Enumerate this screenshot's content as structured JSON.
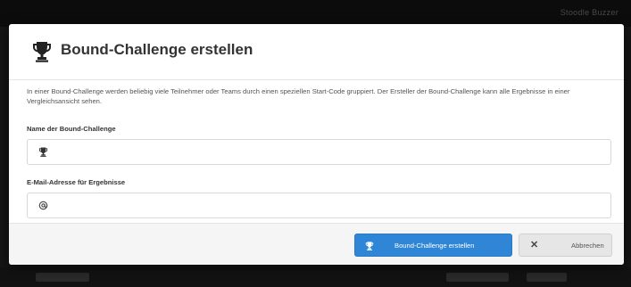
{
  "background": {
    "topbar_text": "Stoodle Buzzer"
  },
  "modal": {
    "title": "Bound-Challenge erstellen",
    "title_icon": "trophy-icon",
    "intro": "In einer Bound-Challenge werden beliebig viele Teilnehmer oder Teams durch einen speziellen Start-Code gruppiert. Der Ersteller der Bound-Challenge kann alle Ergebnisse in einer Vergleichsansicht sehen.",
    "fields": {
      "name": {
        "label": "Name der Bound-Challenge",
        "icon": "trophy-icon",
        "value": ""
      },
      "email": {
        "label": "E-Mail-Adresse für Ergebnisse",
        "icon": "at-icon",
        "value": ""
      }
    },
    "footer": {
      "create_label": "Bound-Challenge erstellen",
      "create_icon": "trophy-icon",
      "cancel_label": "Abbrechen",
      "cancel_icon": "close-icon"
    }
  },
  "colors": {
    "primary": "#2f86d6",
    "backdrop": "#151515",
    "modal_bg": "#ffffff",
    "footer_bg": "#f5f5f5"
  }
}
